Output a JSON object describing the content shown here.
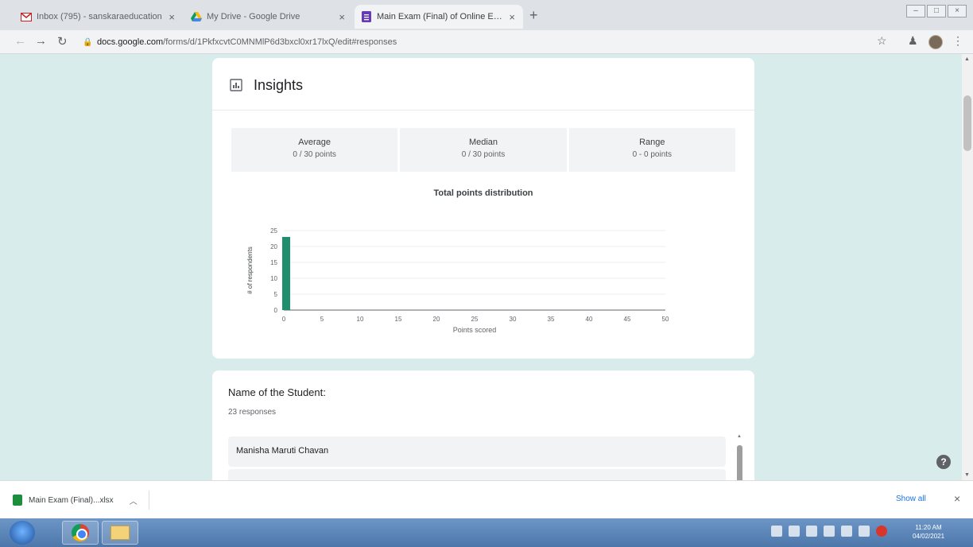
{
  "tabs": [
    {
      "title": "Inbox (795) - sanskaraeducation",
      "icon": "gmail-icon",
      "active": false
    },
    {
      "title": "My Drive - Google Drive",
      "icon": "google-drive-icon",
      "active": false
    },
    {
      "title": "Main Exam (Final) of Online Exam",
      "icon": "google-forms-icon",
      "active": true
    }
  ],
  "toolbar": {
    "url_host": "docs.google.com",
    "url_path": "/forms/d/1PkfxcvtC0MNMlP6d3bxcl0xr17lxQ/edit#responses"
  },
  "insights": {
    "title": "Insights",
    "stats": [
      {
        "label": "Average",
        "value": "0 / 30 points"
      },
      {
        "label": "Median",
        "value": "0 / 30 points"
      },
      {
        "label": "Range",
        "value": "0 - 0 points"
      }
    ],
    "chart_title": "Total points distribution"
  },
  "chart_data": {
    "type": "bar",
    "title": "Total points distribution",
    "xlabel": "Points scored",
    "ylabel": "# of respondents",
    "x": [
      0
    ],
    "values": [
      23
    ],
    "x_ticks": [
      0,
      5,
      10,
      15,
      20,
      25,
      30,
      35,
      40,
      45,
      50
    ],
    "y_ticks": [
      0,
      5,
      10,
      15,
      20,
      25
    ],
    "xlim": [
      0,
      50
    ],
    "ylim": [
      0,
      25
    ],
    "grid": true,
    "color": "#1e8e6e"
  },
  "question": {
    "title": "Name of the Student:",
    "count": "23 responses",
    "responses": [
      "Manisha Maruti Chavan"
    ]
  },
  "download": {
    "file": "Main Exam (Final)...xlsx",
    "show_all": "Show all"
  },
  "taskbar": {
    "clock_time": "11:20 AM",
    "clock_date": "04/02/2021"
  },
  "colors": {
    "page_bg": "#d9ecec",
    "accent": "#1e8e6e"
  }
}
